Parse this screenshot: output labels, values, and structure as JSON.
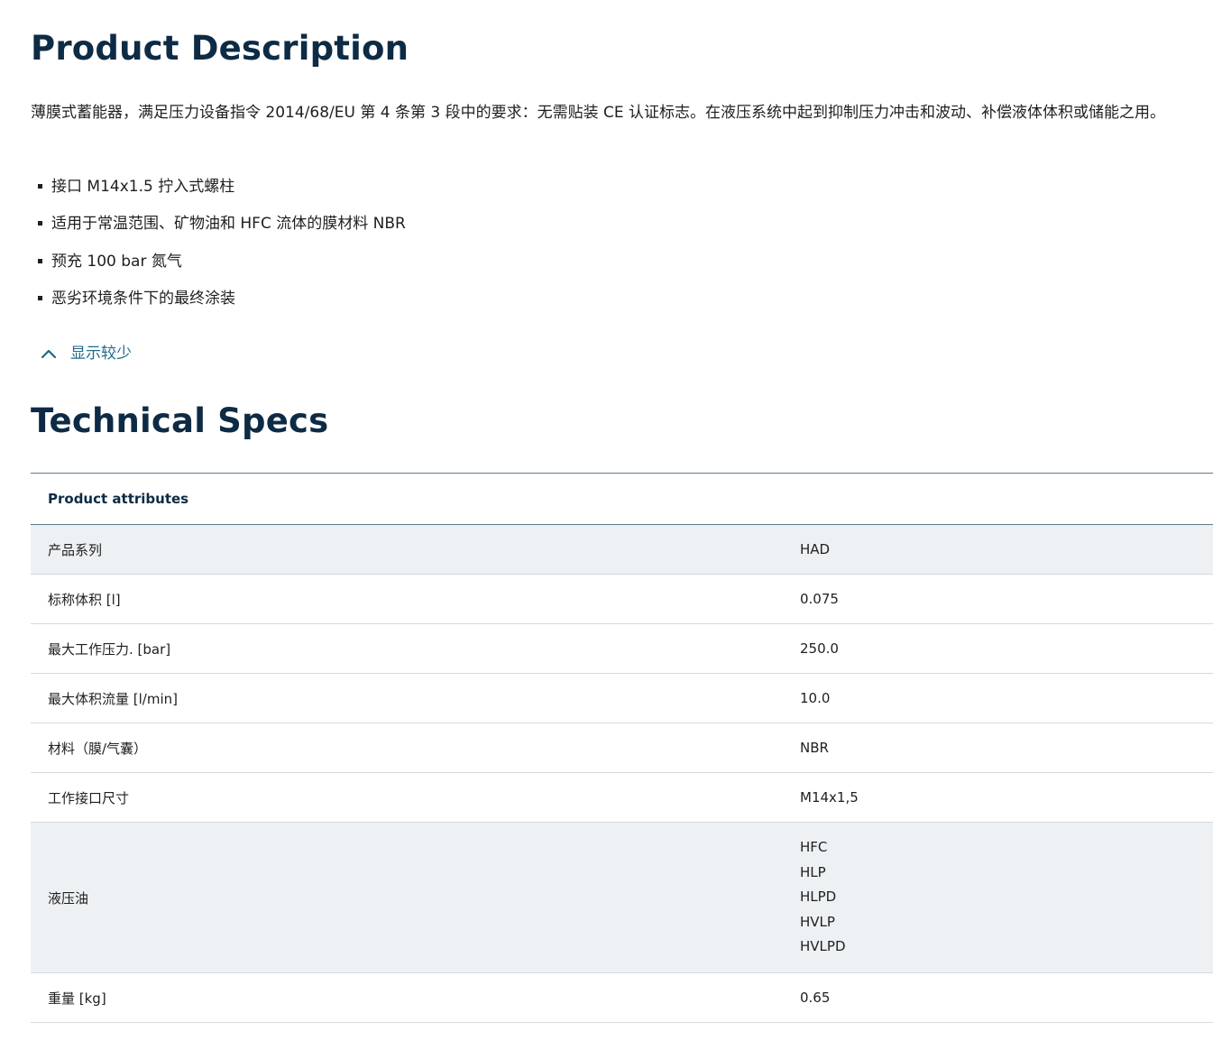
{
  "description": {
    "title": "Product Description",
    "paragraph": "薄膜式蓄能器，满足压力设备指令 2014/68/EU 第 4 条第 3 段中的要求：无需贴装 CE 认证标志。在液压系统中起到抑制压力冲击和波动、补偿液体体积或储能之用。",
    "features": [
      "接口 M14x1.5 拧入式螺柱",
      "适用于常温范围、矿物油和 HFC 流体的膜材料 NBR",
      "预充 100 bar 氮气",
      "恶劣环境条件下的最终涂装"
    ],
    "toggle_label": "显示较少"
  },
  "specs": {
    "title": "Technical Specs",
    "table_header": "Product attributes",
    "rows": [
      {
        "label": "产品系列",
        "value": "HAD"
      },
      {
        "label": "标称体积 [l]",
        "value": "0.075"
      },
      {
        "label": "最大工作压力. [bar]",
        "value": "250.0"
      },
      {
        "label": "最大体积流量 [l/min]",
        "value": "10.0"
      },
      {
        "label": "材料（膜/气囊）",
        "value": "NBR"
      },
      {
        "label": "工作接口尺寸",
        "value": "M14x1,5"
      },
      {
        "label": "液压油",
        "values": [
          "HFC",
          "HLP",
          "HLPD",
          "HVLP",
          "HVLPD"
        ]
      },
      {
        "label": "重量 [kg]",
        "value": "0.65"
      }
    ]
  },
  "colors": {
    "heading": "#0d2b45",
    "link": "#1f6a8a",
    "row_shade": "#edf1f4"
  }
}
